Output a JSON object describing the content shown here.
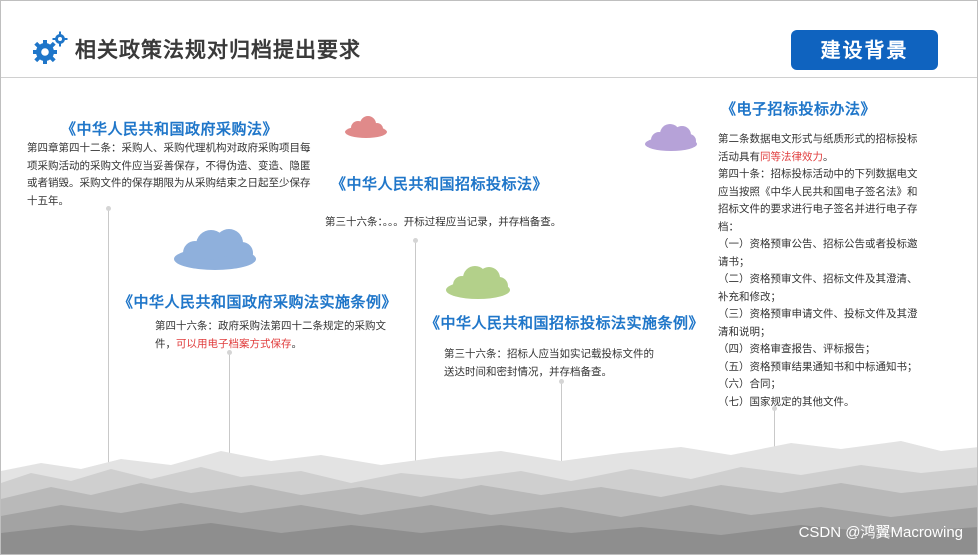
{
  "header": {
    "title": "相关政策法规对归档提出要求",
    "badge": "建设背景"
  },
  "laws": {
    "procurement": {
      "title": "《中华人民共和国政府采购法》",
      "body": "第四章第四十二条：采购人、采购代理机构对政府采购项目每项采购活动的采购文件应当妥善保存，不得伪造、变造、隐匿或者销毁。采购文件的保存期限为从采购结束之日起至少保存十五年。"
    },
    "bidding": {
      "title": "《中华人民共和国招标投标法》",
      "body": "第三十六条：。。。开标过程应当记录，并存档备查。"
    },
    "procurement_regulations": {
      "title": "《中华人民共和国政府采购法实施条例》",
      "body_prefix": "第四十六条：政府采购法第四十二条规定的采购文件，",
      "body_highlight": "可以用电子档案方式保存",
      "body_suffix": "。"
    },
    "bidding_regulations": {
      "title": "《中华人民共和国招标投标法实施条例》",
      "body": "第三十六条：招标人应当如实记载投标文件的送达时间和密封情况，并存档备查。"
    },
    "electronic": {
      "title": "《电子招标投标办法》",
      "article2_prefix": "第二条数据电文形式与纸质形式的招标投标活动具有",
      "article2_highlight": "同等法律效力",
      "article2_suffix": "。",
      "article10": "第四十条：招标投标活动中的下列数据电文应当按照《中华人民共和国电子签名法》和招标文件的要求进行电子签名并进行电子存档：",
      "items": [
        "（一）资格预审公告、招标公告或者投标邀请书；",
        "（二）资格预审文件、招标文件及其澄清、补充和修改；",
        "（三）资格预审申请文件、投标文件及其澄清和说明；",
        "（四）资格审查报告、评标报告；",
        "（五）资格预审结果通知书和中标通知书；",
        "（六）合同；",
        "（七）国家规定的其他文件。"
      ]
    }
  },
  "watermark": "CSDN @鸿翼Macrowing",
  "colors": {
    "title_blue": "#1f76c9",
    "badge_blue": "#0f63bf",
    "highlight_red": "#e03c3c",
    "cloud_red": "#e08a8a",
    "cloud_blue": "#8fb0dc",
    "cloud_green": "#b3d08a",
    "cloud_purple": "#b6a2d8"
  },
  "icons": {
    "header": "gear-icon"
  }
}
